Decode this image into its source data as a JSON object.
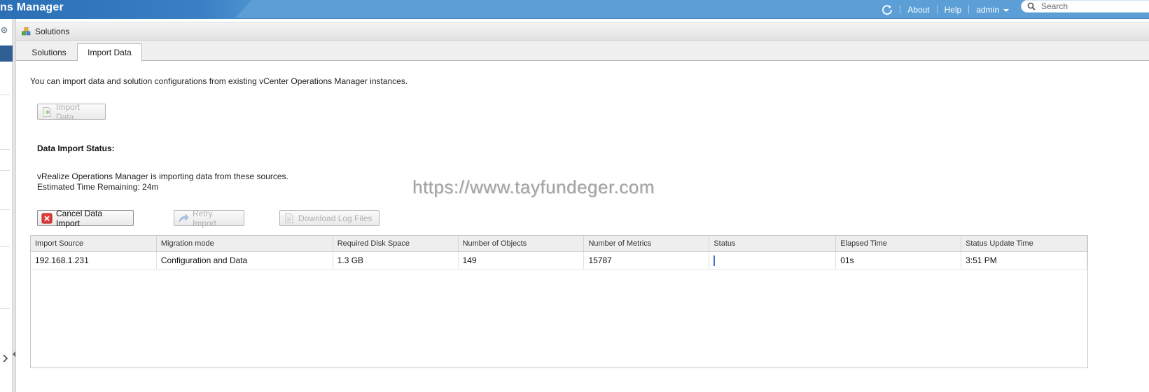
{
  "header": {
    "app_title": "ns Manager",
    "about_label": "About",
    "help_label": "Help",
    "user_label": "admin",
    "search_placeholder": "Search"
  },
  "panel": {
    "title": "Solutions",
    "tabs": [
      {
        "label": "Solutions",
        "active": false
      },
      {
        "label": "Import Data",
        "active": true
      }
    ]
  },
  "import_page": {
    "intro": "You can import data and solution configurations from existing vCenter Operations Manager instances.",
    "import_button": "Import Data",
    "status_heading": "Data Import Status:",
    "status_line1": "vRealize Operations Manager is importing data from these sources.",
    "status_line2": "Estimated Time Remaining: 24m",
    "cancel_button": "Cancel Data Import",
    "retry_button": "Retry Import",
    "download_button": "Download Log Files",
    "watermark": "https://www.tayfundeger.com"
  },
  "table": {
    "columns": [
      "Import Source",
      "Migration mode",
      "Required Disk Space",
      "Number of Objects",
      "Number of Metrics",
      "Status",
      "Elapsed Time",
      "Status Update Time"
    ],
    "rows": [
      {
        "import_source": "192.168.1.231",
        "migration_mode": "Configuration and Data",
        "required_disk_space": "1.3 GB",
        "number_of_objects": "149",
        "number_of_metrics": "15787",
        "status": "",
        "elapsed_time": "01s",
        "status_update_time": "3:51 PM"
      }
    ]
  },
  "icons": {
    "refresh": "refresh-icon",
    "search": "search-icon",
    "solutions": "solutions-icon",
    "import": "import-data-icon",
    "cancel": "cancel-icon",
    "retry": "retry-icon",
    "download": "download-log-icon"
  },
  "colors": {
    "header_blue": "#5b9fd6",
    "title_band": "#2b6fb6",
    "rail_selection": "#2f5f93",
    "cancel_red": "#e23b3b",
    "progress_blue": "#3c7bd0"
  }
}
